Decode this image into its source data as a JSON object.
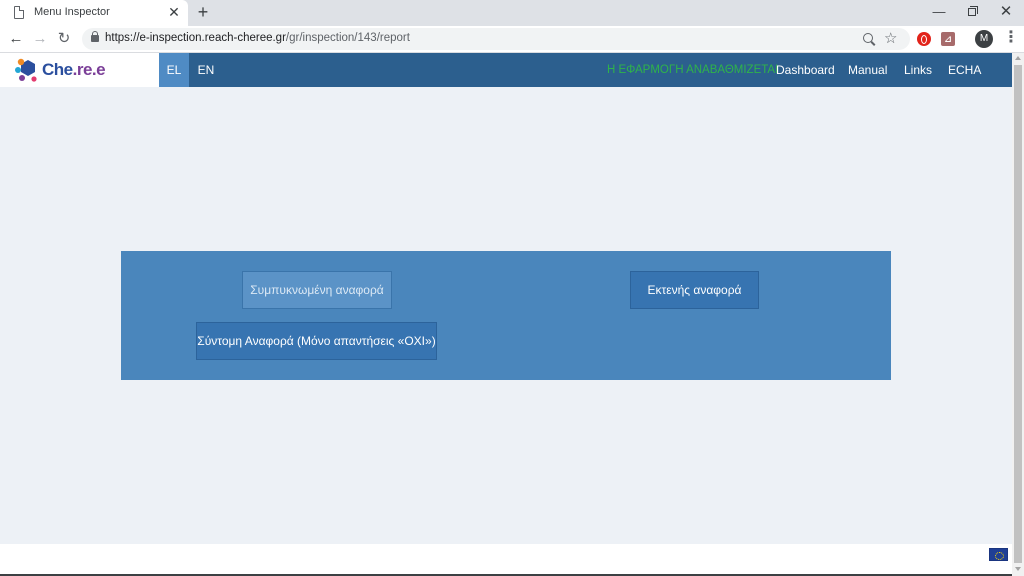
{
  "browser": {
    "tab_title": "Menu Inspector",
    "tab_close": "✕",
    "new_tab": "+",
    "window_minimize": "—",
    "window_close": "✕",
    "back": "←",
    "forward": "→",
    "reload": "↻",
    "star": "☆",
    "url_host": "https://e-inspection.reach-cheree.gr",
    "url_path": "/gr/inspection/143/report",
    "profile_initial": "M",
    "menu": "⋮"
  },
  "site": {
    "logo_main": "Che",
    "logo_accent": ".re.e",
    "logo_colors": {
      "blue": "#2b4f9e",
      "purple": "#7b3f98",
      "orange": "#f08a24",
      "cyan": "#23a6d5"
    },
    "languages": [
      {
        "code": "EL",
        "active": true
      },
      {
        "code": "EN",
        "active": false
      }
    ],
    "nav": {
      "update_notice": "Η ΕΦΑΡΜΟΓΗ ΑΝΑΒΑΘΜΙΖΕΤΑΙ",
      "dashboard": "Dashboard",
      "manual": "Manual",
      "links": "Links",
      "echa": "ECHA"
    }
  },
  "report_panel": {
    "condensed_report": "Συμπυκνωμένη αναφορά",
    "extended_report": "Εκτενής αναφορά",
    "short_report": "Σύντομη Αναφορά (Μόνο απαντήσεις «ΟΧΙ»)"
  },
  "colors": {
    "nav_bar": "#2c5f8e",
    "panel": "#4a86bc",
    "button": "#3774b1",
    "update_notice": "#2fb34a",
    "page_background": "#edf1f6"
  }
}
